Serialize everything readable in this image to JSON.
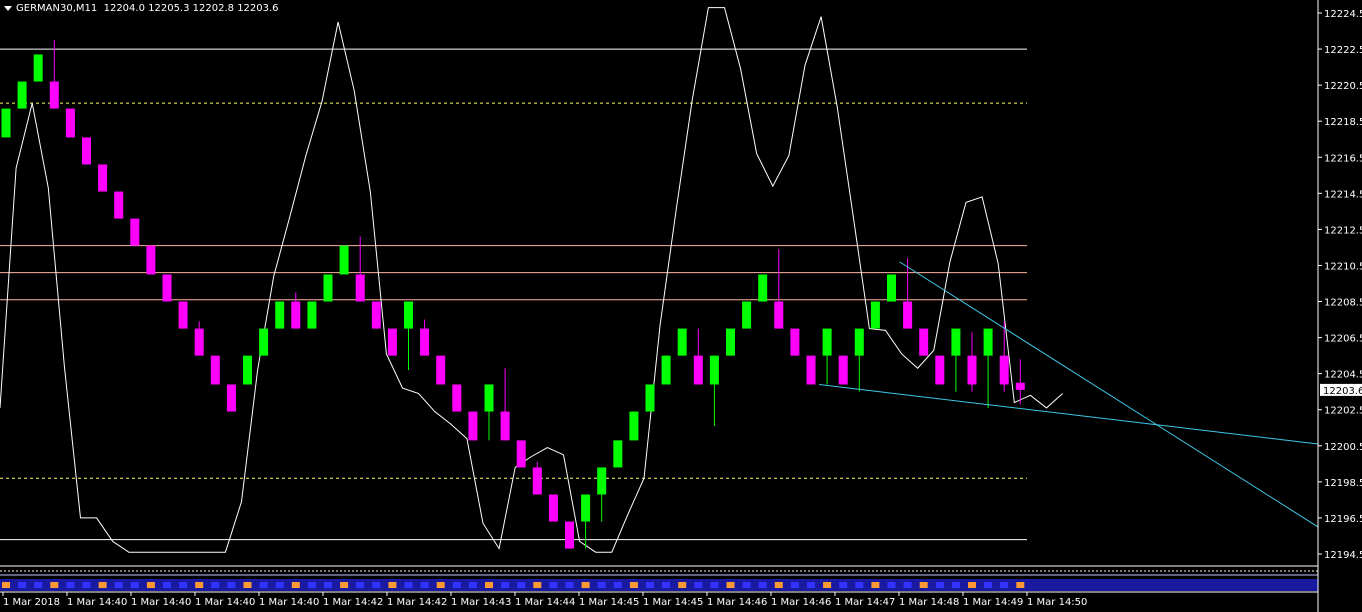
{
  "header": {
    "symbol": "GERMAN30,M11",
    "ohlc": "12204.0 12205.3 12202.8 12203.6"
  },
  "current_price": "12203.6",
  "colors": {
    "background": "#000000",
    "bull": "#00ff00",
    "bear": "#ff00ff",
    "axis": "#ffffff",
    "osc_line": "#ffffff",
    "level_red": "#ffb3a0",
    "level_white": "#ffffff",
    "level_yellow": "#ffff66",
    "trend": "#40c8e8"
  },
  "chart_data": {
    "type": "candlestick",
    "y_axis_ticks": [
      "12224.5",
      "12222.5",
      "12220.5",
      "12218.5",
      "12216.5",
      "12214.5",
      "12212.5",
      "12210.5",
      "12208.5",
      "12206.5",
      "12204.5",
      "12202.5",
      "12200.5",
      "12198.5",
      "12196.5",
      "12194.5"
    ],
    "ylim": [
      12194.0,
      12225.0
    ],
    "x_axis_ticks": [
      "1 Mar 2018",
      "1 Mar 14:40",
      "1 Mar 14:40",
      "1 Mar 14:40",
      "1 Mar 14:40",
      "1 Mar 14:42",
      "1 Mar 14:42",
      "1 Mar 14:43",
      "1 Mar 14:44",
      "1 Mar 14:45",
      "1 Mar 14:45",
      "1 Mar 14:46",
      "1 Mar 14:46",
      "1 Mar 14:47",
      "1 Mar 14:48",
      "1 Mar 14:49",
      "1 Mar 14:50"
    ],
    "candles": [
      {
        "o": 12217.6,
        "h": 12219.2,
        "l": 12217.6,
        "c": 12219.2
      },
      {
        "o": 12219.2,
        "h": 12220.7,
        "l": 12219.2,
        "c": 12220.7
      },
      {
        "o": 12220.7,
        "h": 12222.2,
        "l": 12220.7,
        "c": 12222.2
      },
      {
        "o": 12220.7,
        "h": 12223.0,
        "l": 12219.2,
        "c": 12219.2
      },
      {
        "o": 12219.2,
        "h": 12219.2,
        "l": 12217.6,
        "c": 12217.6
      },
      {
        "o": 12217.6,
        "h": 12217.6,
        "l": 12216.1,
        "c": 12216.1
      },
      {
        "o": 12216.1,
        "h": 12216.1,
        "l": 12214.6,
        "c": 12214.6
      },
      {
        "o": 12214.6,
        "h": 12214.6,
        "l": 12213.1,
        "c": 12213.1
      },
      {
        "o": 12213.1,
        "h": 12213.1,
        "l": 12211.6,
        "c": 12211.6
      },
      {
        "o": 12211.6,
        "h": 12211.6,
        "l": 12210.0,
        "c": 12210.0
      },
      {
        "o": 12210.0,
        "h": 12210.0,
        "l": 12208.5,
        "c": 12208.5
      },
      {
        "o": 12208.5,
        "h": 12208.5,
        "l": 12207.0,
        "c": 12207.0
      },
      {
        "o": 12207.0,
        "h": 12207.4,
        "l": 12205.5,
        "c": 12205.5
      },
      {
        "o": 12205.5,
        "h": 12205.5,
        "l": 12203.9,
        "c": 12203.9
      },
      {
        "o": 12203.9,
        "h": 12203.9,
        "l": 12202.4,
        "c": 12202.4
      },
      {
        "o": 12203.9,
        "h": 12205.5,
        "l": 12203.9,
        "c": 12205.5
      },
      {
        "o": 12205.5,
        "h": 12207.0,
        "l": 12205.5,
        "c": 12207.0
      },
      {
        "o": 12207.0,
        "h": 12208.5,
        "l": 12207.0,
        "c": 12208.5
      },
      {
        "o": 12208.5,
        "h": 12209.0,
        "l": 12207.0,
        "c": 12207.0
      },
      {
        "o": 12207.0,
        "h": 12208.5,
        "l": 12207.0,
        "c": 12208.5
      },
      {
        "o": 12208.5,
        "h": 12210.0,
        "l": 12208.5,
        "c": 12210.0
      },
      {
        "o": 12210.0,
        "h": 12211.6,
        "l": 12210.0,
        "c": 12211.6
      },
      {
        "o": 12210.0,
        "h": 12212.1,
        "l": 12208.5,
        "c": 12208.5
      },
      {
        "o": 12208.5,
        "h": 12208.5,
        "l": 12207.0,
        "c": 12207.0
      },
      {
        "o": 12207.0,
        "h": 12207.0,
        "l": 12205.5,
        "c": 12205.5
      },
      {
        "o": 12207.0,
        "h": 12208.5,
        "l": 12204.7,
        "c": 12208.5
      },
      {
        "o": 12207.0,
        "h": 12207.5,
        "l": 12205.5,
        "c": 12205.5
      },
      {
        "o": 12205.5,
        "h": 12205.5,
        "l": 12203.9,
        "c": 12203.9
      },
      {
        "o": 12203.9,
        "h": 12203.9,
        "l": 12202.4,
        "c": 12202.4
      },
      {
        "o": 12202.4,
        "h": 12202.4,
        "l": 12200.8,
        "c": 12200.8
      },
      {
        "o": 12202.4,
        "h": 12203.9,
        "l": 12200.8,
        "c": 12203.9
      },
      {
        "o": 12202.4,
        "h": 12204.8,
        "l": 12200.8,
        "c": 12200.8
      },
      {
        "o": 12200.8,
        "h": 12200.8,
        "l": 12199.3,
        "c": 12199.3
      },
      {
        "o": 12199.3,
        "h": 12199.6,
        "l": 12197.8,
        "c": 12197.8
      },
      {
        "o": 12197.8,
        "h": 12197.8,
        "l": 12196.3,
        "c": 12196.3
      },
      {
        "o": 12196.3,
        "h": 12196.3,
        "l": 12194.8,
        "c": 12194.8
      },
      {
        "o": 12196.3,
        "h": 12197.8,
        "l": 12194.8,
        "c": 12197.8
      },
      {
        "o": 12197.8,
        "h": 12199.3,
        "l": 12196.3,
        "c": 12199.3
      },
      {
        "o": 12199.3,
        "h": 12200.8,
        "l": 12199.3,
        "c": 12200.8
      },
      {
        "o": 12200.8,
        "h": 12202.4,
        "l": 12200.8,
        "c": 12202.4
      },
      {
        "o": 12202.4,
        "h": 12203.9,
        "l": 12202.4,
        "c": 12203.9
      },
      {
        "o": 12203.9,
        "h": 12205.5,
        "l": 12203.9,
        "c": 12205.5
      },
      {
        "o": 12205.5,
        "h": 12207.0,
        "l": 12205.5,
        "c": 12207.0
      },
      {
        "o": 12205.5,
        "h": 12207.0,
        "l": 12203.9,
        "c": 12203.9
      },
      {
        "o": 12203.9,
        "h": 12205.5,
        "l": 12201.6,
        "c": 12205.5
      },
      {
        "o": 12205.5,
        "h": 12207.0,
        "l": 12205.5,
        "c": 12207.0
      },
      {
        "o": 12207.0,
        "h": 12208.5,
        "l": 12207.0,
        "c": 12208.5
      },
      {
        "o": 12208.5,
        "h": 12210.0,
        "l": 12208.5,
        "c": 12210.0
      },
      {
        "o": 12208.5,
        "h": 12211.4,
        "l": 12207.0,
        "c": 12207.0
      },
      {
        "o": 12207.0,
        "h": 12207.0,
        "l": 12205.5,
        "c": 12205.5
      },
      {
        "o": 12205.5,
        "h": 12205.5,
        "l": 12203.9,
        "c": 12203.9
      },
      {
        "o": 12205.5,
        "h": 12207.0,
        "l": 12203.9,
        "c": 12207.0
      },
      {
        "o": 12205.5,
        "h": 12205.5,
        "l": 12203.9,
        "c": 12203.9
      },
      {
        "o": 12205.5,
        "h": 12207.0,
        "l": 12203.5,
        "c": 12207.0
      },
      {
        "o": 12207.0,
        "h": 12208.5,
        "l": 12207.0,
        "c": 12208.5
      },
      {
        "o": 12208.5,
        "h": 12210.0,
        "l": 12208.5,
        "c": 12210.0
      },
      {
        "o": 12208.5,
        "h": 12210.9,
        "l": 12207.0,
        "c": 12207.0
      },
      {
        "o": 12207.0,
        "h": 12207.0,
        "l": 12205.5,
        "c": 12205.5
      },
      {
        "o": 12205.5,
        "h": 12205.5,
        "l": 12203.9,
        "c": 12203.9
      },
      {
        "o": 12205.5,
        "h": 12207.0,
        "l": 12203.5,
        "c": 12207.0
      },
      {
        "o": 12205.5,
        "h": 12206.8,
        "l": 12203.5,
        "c": 12203.9
      },
      {
        "o": 12205.5,
        "h": 12207.0,
        "l": 12202.6,
        "c": 12207.0
      },
      {
        "o": 12205.5,
        "h": 12207.4,
        "l": 12203.5,
        "c": 12203.9
      },
      {
        "o": 12204.0,
        "h": 12205.3,
        "l": 12202.8,
        "c": 12203.6
      }
    ],
    "oscillator": [
      12202.6,
      12215.9,
      12219.5,
      12214.8,
      12204.9,
      12196.5,
      12196.5,
      12195.2,
      12194.6,
      12194.6,
      12194.6,
      12194.6,
      12194.6,
      12194.6,
      12194.6,
      12197.4,
      12204.7,
      12209.9,
      12213.2,
      12216.6,
      12219.6,
      12224.0,
      12220.2,
      12214.6,
      12205.6,
      12203.7,
      12203.4,
      12202.4,
      12201.7,
      12200.9,
      12196.2,
      12194.8,
      12199.3,
      12199.9,
      12200.4,
      12200.0,
      12195.2,
      12194.6,
      12194.6,
      12196.7,
      12198.7,
      12207.2,
      12213.6,
      12219.7,
      12224.8,
      12224.8,
      12221.4,
      12216.7,
      12214.9,
      12216.6,
      12221.6,
      12224.3,
      12219.3,
      12213.2,
      12207.0,
      12206.9,
      12205.6,
      12204.8,
      12205.8,
      12210.7,
      12214.0,
      12214.3,
      12210.6,
      12202.9,
      12203.3,
      12202.6,
      12203.4
    ],
    "h_levels_white": [
      12222.5,
      12195.3
    ],
    "h_levels_yellow": [
      12219.5,
      12198.7
    ],
    "h_levels_red": [
      12211.6,
      12210.1,
      12208.6
    ],
    "trendlines": [
      {
        "x1": 51,
        "y1": 12203.9,
        "x2": 99,
        "y2": 12200.6
      },
      {
        "x1": 56,
        "y1": 12210.7,
        "x2": 99,
        "y2": 12196.0
      }
    ]
  }
}
